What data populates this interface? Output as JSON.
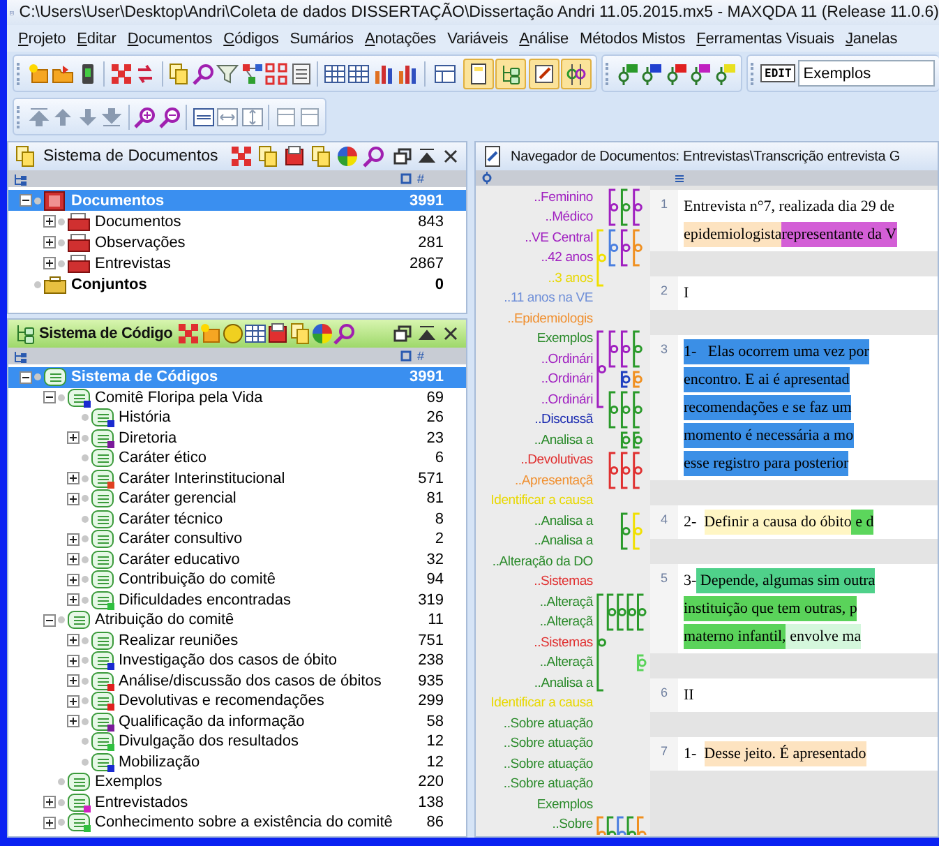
{
  "window": {
    "title": "C:\\Users\\User\\Desktop\\Andri\\Coleta de dados DISSERTAÇÃO\\Dissertação Andri 11.05.2015.mx5 - MAXQDA 11  (Release 11.0.6)"
  },
  "menu": [
    {
      "label": "Projeto",
      "underlined": true
    },
    {
      "label": "Editar",
      "underlined": true
    },
    {
      "label": "Documentos",
      "underlined": true
    },
    {
      "label": "Códigos",
      "underlined": true
    },
    {
      "label": "Sumários",
      "underlined": false
    },
    {
      "label": "Anotações",
      "underlined": true
    },
    {
      "label": "Variáveis",
      "underlined": false
    },
    {
      "label": "Análise",
      "underlined": true
    },
    {
      "label": "Métodos Mistos",
      "underlined": false
    },
    {
      "label": "Ferramentas Visuais",
      "underlined": true
    },
    {
      "label": "Janelas",
      "underlined": true
    }
  ],
  "toolbar": {
    "view_toggles": [
      {
        "on": false
      },
      {
        "on": true
      },
      {
        "on": true
      },
      {
        "on": true
      },
      {
        "on": true
      }
    ],
    "edit_badge": "EDIT",
    "code_combo": "Exemplos"
  },
  "document_system": {
    "title": "Sistema de Documentos",
    "column_count": "#",
    "items": [
      {
        "label": "Documentos",
        "count": "3991",
        "kind": "root",
        "expanded": true,
        "selected": true,
        "children": [
          {
            "label": "Documentos",
            "count": "843",
            "kind": "group",
            "expanded": false,
            "selected": false
          },
          {
            "label": "Observações",
            "count": "281",
            "kind": "group",
            "expanded": false,
            "selected": false
          },
          {
            "label": "Entrevistas",
            "count": "2867",
            "kind": "group",
            "expanded": false,
            "selected": false
          }
        ]
      },
      {
        "label": "Conjuntos",
        "count": "0",
        "kind": "set",
        "selected": false
      }
    ]
  },
  "code_system": {
    "title": "Sistema de Código",
    "column_count": "#",
    "items": [
      {
        "label": "Sistema de Códigos",
        "count": "3991",
        "expanded": true,
        "selected": true,
        "children": [
          {
            "label": "Comitê Floripa pela Vida",
            "count": "69",
            "expanded": true,
            "color": "#1a2ad0",
            "selected": false,
            "children": [
              {
                "label": "História",
                "count": "26",
                "color": "#1a2ad0",
                "selected": false
              },
              {
                "label": "Diretoria",
                "count": "23",
                "expanded": false,
                "color": "#7a1a9a",
                "selected": false
              },
              {
                "label": "Caráter ético",
                "count": "6",
                "selected": false
              },
              {
                "label": "Caráter Interinstitucional",
                "count": "571",
                "expanded": false,
                "color": "#e04020",
                "selected": false
              },
              {
                "label": "Caráter gerencial",
                "count": "81",
                "expanded": false,
                "selected": false
              },
              {
                "label": "Caráter técnico",
                "count": "8",
                "selected": false
              },
              {
                "label": "Caráter consultivo",
                "count": "2",
                "expanded": false,
                "selected": false
              },
              {
                "label": "Caráter educativo",
                "count": "32",
                "expanded": false,
                "selected": false
              },
              {
                "label": "Contribuição do comitê",
                "count": "94",
                "expanded": false,
                "selected": false
              },
              {
                "label": "Dificuldades encontradas",
                "count": "319",
                "expanded": false,
                "color": "#30c040",
                "selected": false
              }
            ]
          },
          {
            "label": "Atribuição do comitê",
            "count": "11",
            "expanded": true,
            "selected": false,
            "children": [
              {
                "label": "Realizar reuniões",
                "count": "751",
                "expanded": false,
                "selected": false
              },
              {
                "label": "Investigação dos casos de óbito",
                "count": "238",
                "expanded": false,
                "color": "#1a2ad0",
                "selected": false
              },
              {
                "label": "Análise/discussão dos casos de óbitos",
                "count": "935",
                "expanded": false,
                "color": "#e02020",
                "selected": false
              },
              {
                "label": "Devolutivas e recomendações",
                "count": "299",
                "expanded": false,
                "color": "#e02020",
                "selected": false
              },
              {
                "label": "Qualificação da informação",
                "count": "58",
                "expanded": false,
                "color": "#7a1a9a",
                "selected": false
              },
              {
                "label": "Divulgação dos resultados",
                "count": "12",
                "color": "#30c040",
                "selected": false
              },
              {
                "label": "Mobilização",
                "count": "12",
                "color": "#1a2ad0",
                "selected": false
              }
            ]
          },
          {
            "label": "Exemplos",
            "count": "220",
            "selected": false
          },
          {
            "label": "Entrevistados",
            "count": "138",
            "expanded": false,
            "color": "#d020c0",
            "selected": false
          },
          {
            "label": "Conhecimento sobre a existência do comitê",
            "count": "86",
            "expanded": false,
            "color": "#30c040",
            "selected": false
          }
        ]
      }
    ]
  },
  "document_browser": {
    "title": "Navegador de Documentos: Entrevistas\\Transcrição entrevista G",
    "codes": [
      {
        "label": "..Feminino",
        "color": "#a020c0"
      },
      {
        "label": "..Médico",
        "color": "#a020c0"
      },
      {
        "label": "..VE Central",
        "color": "#a020c0"
      },
      {
        "label": "..42 anos",
        "color": "#a020c0"
      },
      {
        "label": "..3 anos",
        "color": "#e8d800"
      },
      {
        "label": "..11 anos na VE",
        "color": "#6f8fd8"
      },
      {
        "label": "..Epidemiologis",
        "color": "#f09030"
      },
      {
        "label": "Exemplos",
        "color": "#2a8a2a"
      },
      {
        "label": "..Ordinári",
        "color": "#a020c0"
      },
      {
        "label": "..Ordinári",
        "color": "#a020c0"
      },
      {
        "label": "..Ordinári",
        "color": "#a020c0"
      },
      {
        "label": "..Discussã",
        "color": "#1a2ab0"
      },
      {
        "label": "..Analisa a",
        "color": "#2a8a2a"
      },
      {
        "label": "..Devolutivas",
        "color": "#e03030"
      },
      {
        "label": "..Apresentaçã",
        "color": "#f09030"
      },
      {
        "label": "Identificar a causa",
        "color": "#e8d800"
      },
      {
        "label": "..Analisa a",
        "color": "#2a8a2a"
      },
      {
        "label": "..Analisa a",
        "color": "#2a8a2a"
      },
      {
        "label": "..Alteração da DO",
        "color": "#2a8a2a"
      },
      {
        "label": "..Sistemas",
        "color": "#e03030"
      },
      {
        "label": "..Alteraçã",
        "color": "#2a8a2a"
      },
      {
        "label": "..Alteraçã",
        "color": "#2a8a2a"
      },
      {
        "label": "..Sistemas",
        "color": "#e03030"
      },
      {
        "label": "..Alteraçã",
        "color": "#2a8a2a"
      },
      {
        "label": "..Analisa a",
        "color": "#2a8a2a"
      },
      {
        "label": "Identificar a causa",
        "color": "#e8d800"
      },
      {
        "label": "..Sobre atuação",
        "color": "#2a8a2a"
      },
      {
        "label": "..Sobre atuação",
        "color": "#2a8a2a"
      },
      {
        "label": "..Sobre atuação",
        "color": "#2a8a2a"
      },
      {
        "label": "..Sobre atuação",
        "color": "#2a8a2a"
      },
      {
        "label": "Exemplos",
        "color": "#2a8a2a"
      },
      {
        "label": "..Sobre",
        "color": "#2a8a2a"
      }
    ],
    "paragraphs": [
      {
        "number": "1",
        "lines": [
          [
            {
              "text": "Entrevista n°7, realizada dia 29 de"
            }
          ],
          [
            {
              "text": "epidemiologista",
              "color": "#fde3c0"
            },
            {
              "text": "representante da V",
              "color": "#d35fd6"
            }
          ]
        ]
      },
      {
        "number": "2",
        "lines": [
          [
            {
              "text": "I"
            }
          ]
        ]
      },
      {
        "number": "3",
        "lines": [
          [
            {
              "text": "1-   Elas ocorrem uma vez por",
              "color": "#3b8fe6"
            }
          ],
          [
            {
              "text": "encontro. E ai é apresentad",
              "color": "#3b8fe6"
            }
          ],
          [
            {
              "text": "recomendações e se faz um",
              "color": "#3b8fe6"
            }
          ],
          [
            {
              "text": "momento é necessária a mo",
              "color": "#3b8fe6"
            }
          ],
          [
            {
              "text": "esse registro para posterior",
              "color": "#3b8fe6"
            }
          ]
        ]
      },
      {
        "number": "4",
        "lines": [
          [
            {
              "text": "2-  "
            },
            {
              "text": "Definir a causa do óbito",
              "color": "#fff6c4"
            },
            {
              "text": " e d",
              "color": "#5cd65c"
            }
          ]
        ]
      },
      {
        "number": "5",
        "lines": [
          [
            {
              "text": "3-"
            },
            {
              "text": " Depende, algumas sim outra",
              "color": "#4fd18a"
            }
          ],
          [
            {
              "text": "instituição que tem outras, p",
              "color": "#5ad35a"
            }
          ],
          [
            {
              "text": "materno infantil,",
              "color": "#5ad35a"
            },
            {
              "text": " envolve ma",
              "color": "#d4f7dc"
            }
          ]
        ]
      },
      {
        "number": "6",
        "lines": [
          [
            {
              "text": "II"
            }
          ]
        ]
      },
      {
        "number": "7",
        "lines": [
          [
            {
              "text": "1-  "
            },
            {
              "text": "Desse jeito. É apresentado",
              "color": "#fde3c0"
            }
          ]
        ]
      }
    ]
  }
}
